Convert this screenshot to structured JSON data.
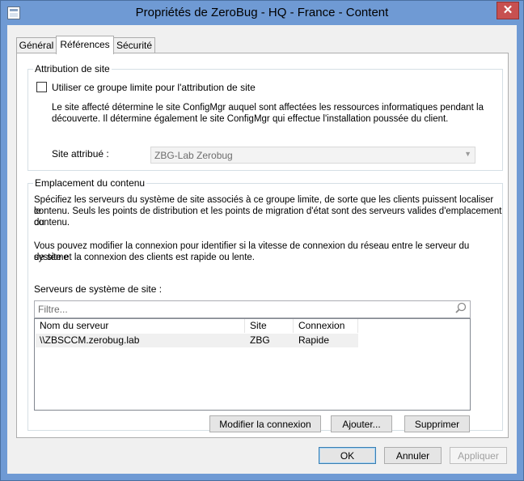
{
  "window": {
    "title": "Propriétés de ZeroBug - HQ - France - Content",
    "close_label": "✕"
  },
  "tabs": [
    {
      "label": "Général"
    },
    {
      "label": "Références"
    },
    {
      "label": "Sécurité"
    }
  ],
  "site_assignment": {
    "legend": "Attribution de site",
    "checkbox_label": "Utiliser ce groupe limite pour l'attribution de site",
    "checked": false,
    "description_line1": "Le site affecté détermine le site ConfigMgr auquel sont affectées les ressources informatiques pendant la",
    "description_line2": "découverte. Il détermine également le site ConfigMgr qui effectue l'installation poussée du client.",
    "assigned_site_label": "Site attribué :",
    "assigned_site_value": "ZBG-Lab Zerobug"
  },
  "content_location": {
    "legend": "Emplacement du contenu",
    "para1_line1": "Spécifiez les serveurs du système de site associés à ce groupe limite, de sorte que les clients puissent localiser le",
    "para1_line2": "contenu. Seuls les points de distribution et les points de migration d'état sont des serveurs valides d'emplacement du",
    "para1_line3": "contenu.",
    "para2_line1": "Vous pouvez modifier la connexion pour identifier si la vitesse de connexion du réseau entre le serveur du système",
    "para2_line2": "de site et la connexion des clients est rapide ou lente.",
    "servers_label": "Serveurs de système de site :",
    "filter_placeholder": "Filtre...",
    "columns": [
      "Nom du serveur",
      "Site",
      "Connexion"
    ],
    "rows": [
      {
        "server": "\\\\ZBSCCM.zerobug.lab",
        "site": "ZBG",
        "connection": "Rapide"
      }
    ],
    "buttons": {
      "modify": "Modifier la connexion",
      "add": "Ajouter...",
      "remove": "Supprimer"
    }
  },
  "dialog_buttons": {
    "ok": "OK",
    "cancel": "Annuler",
    "apply": "Appliquer"
  },
  "colors": {
    "titlebar": "#6f9ad4",
    "close": "#c75050",
    "face": "#f0f0f0"
  }
}
